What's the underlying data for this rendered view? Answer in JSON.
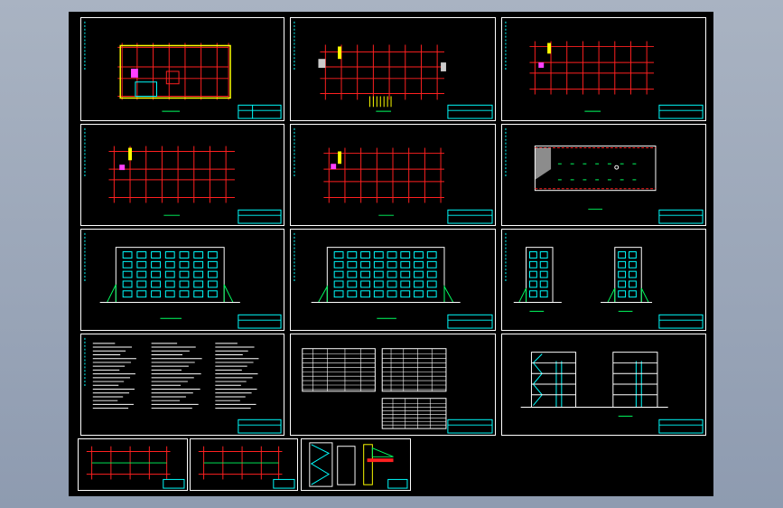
{
  "viewer": {
    "background_color": "#9aa6b8",
    "canvas_color": "#000000",
    "line_colors": {
      "border": "#ffffff",
      "grid_axis": "#ff2020",
      "wall": "#ffff00",
      "detail": "#00ffff",
      "green": "#00ff60",
      "magenta": "#ff40ff"
    }
  },
  "sheets": [
    {
      "id": "s1",
      "type": "floor-plan"
    },
    {
      "id": "s2",
      "type": "floor-plan"
    },
    {
      "id": "s3",
      "type": "floor-plan"
    },
    {
      "id": "s4",
      "type": "floor-plan"
    },
    {
      "id": "s5",
      "type": "floor-plan"
    },
    {
      "id": "s6",
      "type": "roof-plan"
    },
    {
      "id": "s7",
      "type": "elevation"
    },
    {
      "id": "s8",
      "type": "elevation"
    },
    {
      "id": "s9",
      "type": "side-elevations"
    },
    {
      "id": "s10",
      "type": "notes"
    },
    {
      "id": "s11",
      "type": "schedule-tables"
    },
    {
      "id": "s12",
      "type": "sections"
    },
    {
      "id": "s13",
      "type": "structural-plan"
    },
    {
      "id": "s14",
      "type": "structural-plan"
    },
    {
      "id": "s15",
      "type": "stair-details"
    }
  ]
}
